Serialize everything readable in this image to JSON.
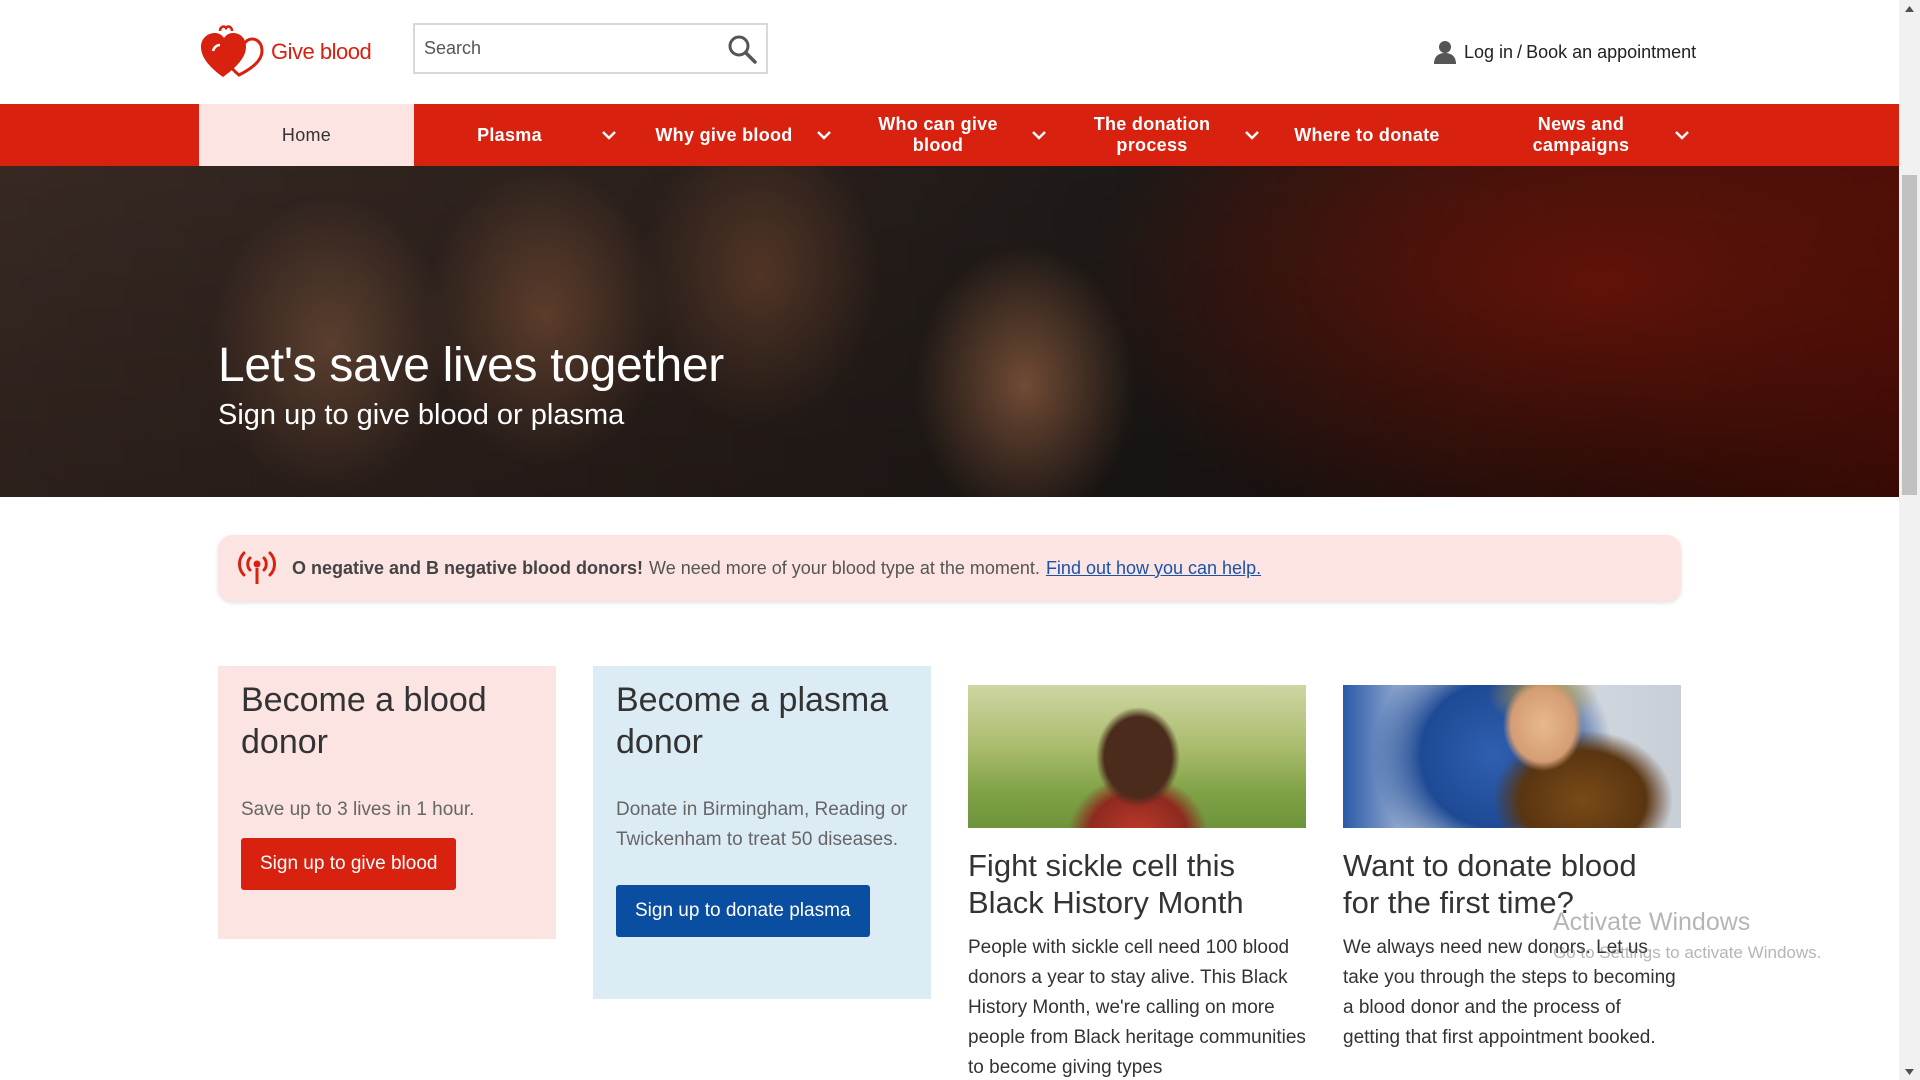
{
  "header": {
    "logo_text": "Give blood",
    "search_placeholder": "Search",
    "login_label": "Log in",
    "login_sep": "/",
    "book_label": "Book an appointment"
  },
  "nav": {
    "items": [
      {
        "label": "Home",
        "active": true
      },
      {
        "label": "Plasma"
      },
      {
        "label": "Why give blood"
      },
      {
        "label": "Who can give blood"
      },
      {
        "label": "The donation process"
      },
      {
        "label": "Where to donate"
      },
      {
        "label": "News and campaigns"
      }
    ]
  },
  "hero": {
    "title": "Let's save lives together",
    "subtitle": "Sign up to give blood or plasma"
  },
  "alert": {
    "bold": "O negative and B negative blood donors!",
    "text": "We need more of your blood type at the moment.",
    "link": "Find out how you can help."
  },
  "cards": {
    "blood": {
      "title": "Become a blood donor",
      "text": "Save up to 3 lives in 1 hour.",
      "button": "Sign up to give blood"
    },
    "plasma": {
      "title": "Become a plasma donor",
      "text": "Donate in Birmingham, Reading or Twickenham to treat 50 diseases.",
      "button": "Sign up to donate plasma"
    }
  },
  "articles": [
    {
      "title": "Fight sickle cell this Black History Month",
      "text": "People with sickle cell need 100 blood donors a year to stay alive. This Black History Month, we're calling on more people from Black heritage communities to become giving types"
    },
    {
      "title": "Want to donate blood for the first time?",
      "text": "We always need new donors. Let us take you through the steps to becoming a blood donor and the process of getting that first appointment booked."
    }
  ],
  "watermark": {
    "title": "Activate Windows",
    "subtitle": "Go to Settings to activate Windows."
  },
  "colors": {
    "brand_red": "#d8210f",
    "nav_active_bg": "#fbe4e2",
    "plasma_bg": "#dcecf5",
    "plasma_button": "#0a4ea2",
    "link_blue": "#1a53a8"
  }
}
